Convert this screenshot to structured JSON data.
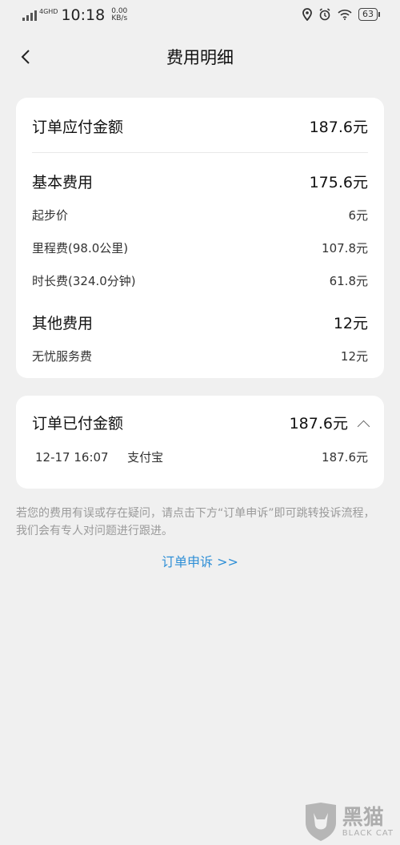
{
  "status": {
    "network": "4GHD",
    "time": "10:18",
    "speed_value": "0.00",
    "speed_unit": "KB/s",
    "battery": "63"
  },
  "nav": {
    "title": "费用明细"
  },
  "payable": {
    "label": "订单应付金额",
    "amount": "187.6元"
  },
  "basic": {
    "label": "基本费用",
    "amount": "175.6元",
    "items": [
      {
        "label": "起步价",
        "amount": "6元"
      },
      {
        "label": "里程费(98.0公里)",
        "amount": "107.8元"
      },
      {
        "label": "时长费(324.0分钟)",
        "amount": "61.8元"
      }
    ]
  },
  "other": {
    "label": "其他费用",
    "amount": "12元",
    "items": [
      {
        "label": "无忧服务费",
        "amount": "12元"
      }
    ]
  },
  "paid": {
    "label": "订单已付金额",
    "amount": "187.6元",
    "record": {
      "datetime": "12-17 16:07",
      "method": "支付宝",
      "amount": "187.6元"
    }
  },
  "note": "若您的费用有误或存在疑问，请点击下方“订单申诉”即可跳转投诉流程，我们会有专人对问题进行跟进。",
  "appeal_link": "订单申诉 >>",
  "watermark": {
    "main": "黑猫",
    "sub": "BLACK CAT"
  }
}
